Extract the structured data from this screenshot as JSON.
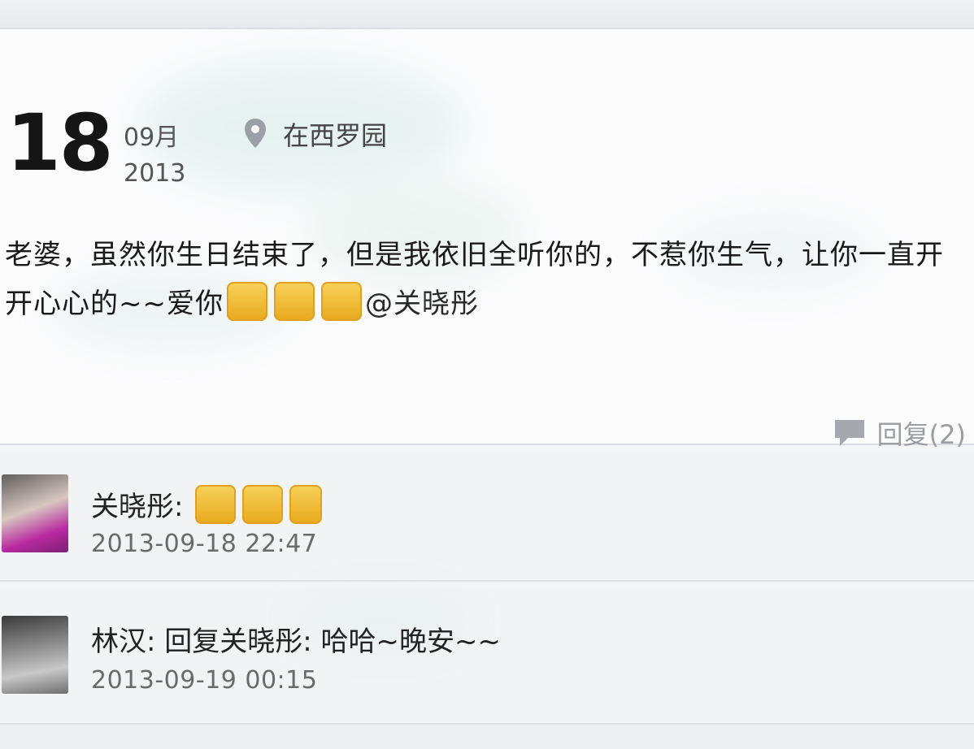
{
  "post": {
    "day": "18",
    "month": "09月",
    "year": "2013",
    "location": "在西罗园",
    "text": "老婆，虽然你生日结束了，但是我依旧全听你的，不惹你生气，让你一直开开心心的~~爱你",
    "mention": "@关晓彤",
    "reply_label": "回复(2)",
    "icons": {
      "location": "location-pin-icon",
      "reply": "comment-bubble-icon",
      "emoji": "emoji-icon"
    }
  },
  "comments": [
    {
      "author": "关晓彤",
      "separator": ":",
      "text": "",
      "time": "2013-09-18 22:47"
    },
    {
      "author": "林汉",
      "separator": ":",
      "text": "回复关晓彤: 哈哈~晚安~~",
      "time": "2013-09-19 00:15"
    }
  ],
  "colors": {
    "accent_emoji": "#f0c23a",
    "muted_text": "#9a9da2",
    "divider": "#d9dde2"
  }
}
